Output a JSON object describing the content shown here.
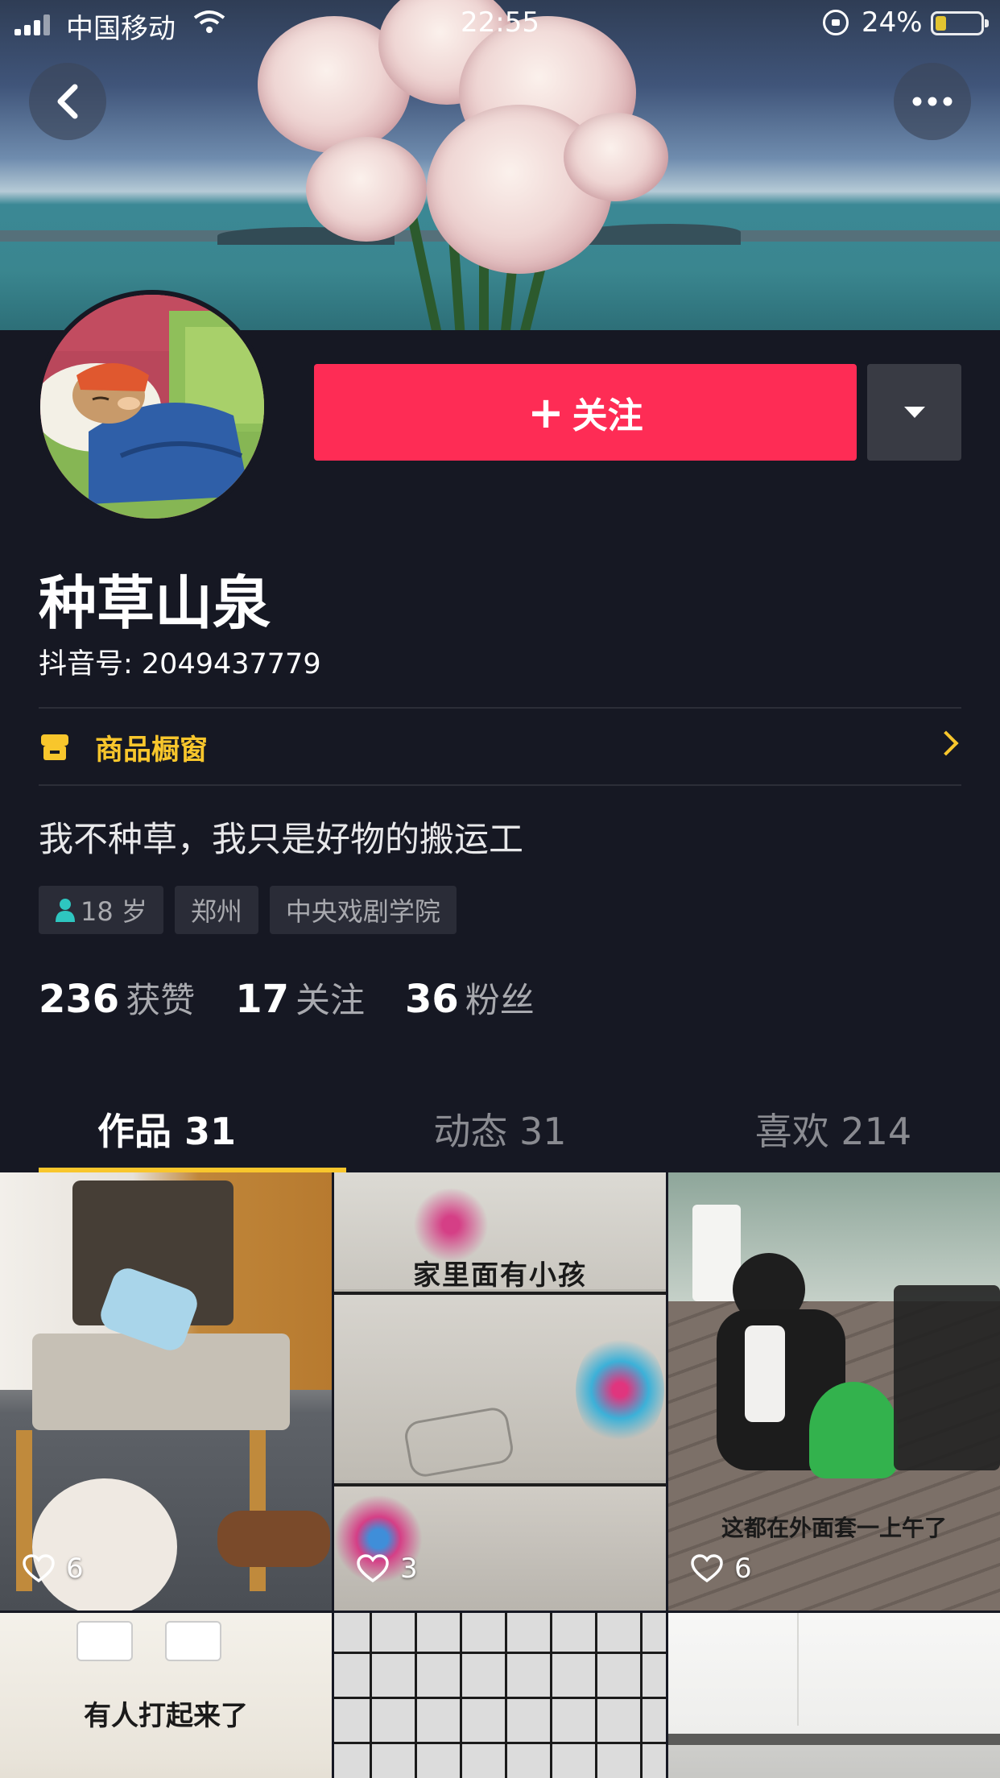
{
  "status_bar": {
    "carrier": "中国移动",
    "time": "22:55",
    "battery_percent": "24%"
  },
  "profile": {
    "follow_label": "关注",
    "name": "种草山泉",
    "douyin_id": "抖音号: 2049437779",
    "shop_label": "商品橱窗",
    "bio": "我不种草，我只是好物的搬运工",
    "tags": [
      "18 岁",
      "郑州",
      "中央戏剧学院"
    ],
    "stats": [
      {
        "value": "236",
        "label": "获赞"
      },
      {
        "value": "17",
        "label": "关注"
      },
      {
        "value": "36",
        "label": "粉丝"
      }
    ]
  },
  "tabs": [
    {
      "label": "作品 31",
      "active": true
    },
    {
      "label": "动态 31",
      "active": false
    },
    {
      "label": "喜欢 214",
      "active": false
    }
  ],
  "videos": [
    {
      "likes": "6",
      "caption": ""
    },
    {
      "likes": "3",
      "caption": "家里面有小孩"
    },
    {
      "likes": "6",
      "caption": "这都在外面套一上午了"
    },
    {
      "likes": "",
      "caption": "有人打起来了"
    },
    {
      "likes": "",
      "caption": ""
    },
    {
      "likes": "",
      "caption": ""
    }
  ],
  "colors": {
    "background": "#161823",
    "follow_button": "#fe2c55",
    "accent_yellow": "#f8c62c"
  },
  "icons": [
    "back-icon",
    "more-icon",
    "plus-icon",
    "dropdown-icon",
    "shop-icon",
    "chevron-right-icon",
    "person-icon",
    "heart-icon"
  ]
}
